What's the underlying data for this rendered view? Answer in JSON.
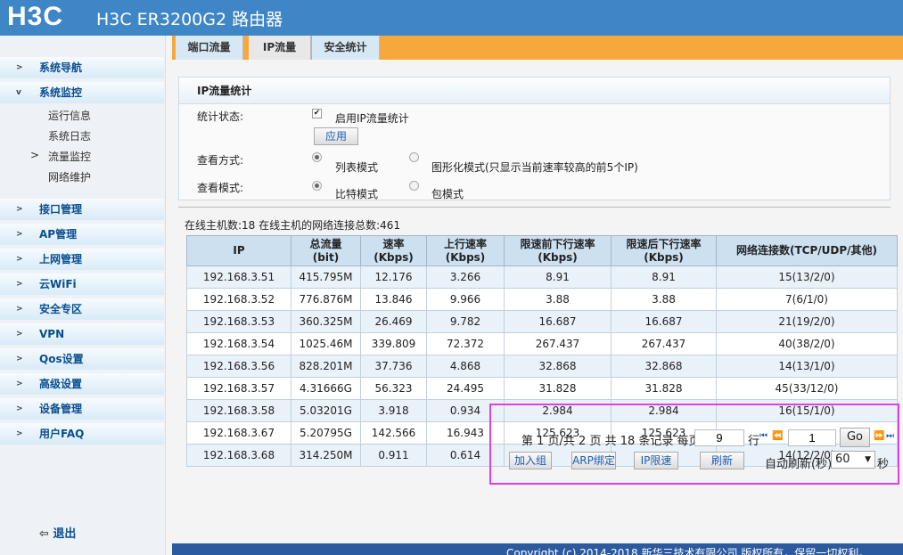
{
  "header": {
    "logo": "H3C",
    "title": "H3C ER3200G2 路由器"
  },
  "sidebar": {
    "items": [
      "系统导航",
      "系统监控",
      "接口管理",
      "AP管理",
      "上网管理",
      "云WiFi",
      "安全专区",
      "VPN",
      "Qos设置",
      "高级设置",
      "设备管理",
      "用户FAQ"
    ],
    "subitems": [
      "运行信息",
      "系统日志",
      "流量监控",
      "网络维护"
    ],
    "logout": "退出"
  },
  "tabs": [
    "端口流量",
    "IP流量",
    "安全统计"
  ],
  "panel": {
    "title": "IP流量统计",
    "stat_label": "统计状态:",
    "enable_label": "启用IP流量统计",
    "enable_checked": true,
    "apply": "应用",
    "view_label": "查看方式:",
    "view_opts": [
      "列表模式",
      "图形化模式(只显示当前速率较高的前5个IP)"
    ],
    "view_selected": "列表模式",
    "mode_label": "查看模式:",
    "mode_opts": [
      "比特模式",
      "包模式"
    ],
    "mode_selected": "比特模式"
  },
  "summary": "在线主机数:18   在线主机的网络连接总数:461",
  "table": {
    "headers": [
      [
        "IP",
        ""
      ],
      [
        "总流量",
        "(bit)"
      ],
      [
        "速率",
        "(Kbps)"
      ],
      [
        "上行速率",
        "(Kbps)"
      ],
      [
        "限速前下行速率",
        "(Kbps)"
      ],
      [
        "限速后下行速率",
        "(Kbps)"
      ],
      [
        "网络连接数(TCP/UDP/其他)",
        ""
      ]
    ],
    "rows": [
      [
        "192.168.3.51",
        "415.795M",
        "12.176",
        "3.266",
        "8.91",
        "8.91",
        "15(13/2/0)"
      ],
      [
        "192.168.3.52",
        "776.876M",
        "13.846",
        "9.966",
        "3.88",
        "3.88",
        "7(6/1/0)"
      ],
      [
        "192.168.3.53",
        "360.325M",
        "26.469",
        "9.782",
        "16.687",
        "16.687",
        "21(19/2/0)"
      ],
      [
        "192.168.3.54",
        "1025.46M",
        "339.809",
        "72.372",
        "267.437",
        "267.437",
        "40(38/2/0)"
      ],
      [
        "192.168.3.56",
        "828.201M",
        "37.736",
        "4.868",
        "32.868",
        "32.868",
        "14(13/1/0)"
      ],
      [
        "192.168.3.57",
        "4.31666G",
        "56.323",
        "24.495",
        "31.828",
        "31.828",
        "45(33/12/0)"
      ],
      [
        "192.168.3.58",
        "5.03201G",
        "3.918",
        "0.934",
        "2.984",
        "2.984",
        "16(15/1/0)"
      ],
      [
        "192.168.3.67",
        "5.20795G",
        "142.566",
        "16.943",
        "125.623",
        "125.623",
        ""
      ],
      [
        "192.168.3.68",
        "314.250M",
        "0.911",
        "0.614",
        "",
        "",
        "14(12/2/0)"
      ]
    ]
  },
  "pager": {
    "text": "第 1 页/共 2 页 共 18 条记录 每页",
    "per_page": "9",
    "rows_unit": "行",
    "page": "1",
    "go": "Go",
    "add_group": "加入组",
    "arp": "ARP绑定",
    "ip_limit": "IP限速",
    "refresh": "刷新",
    "auto_refresh": "自动刷新(秒):",
    "interval": "60",
    "sec": "秒"
  },
  "footer": "Copyright (c) 2014-2018 新华三技术有限公司 版权所有，保留一切权利。"
}
